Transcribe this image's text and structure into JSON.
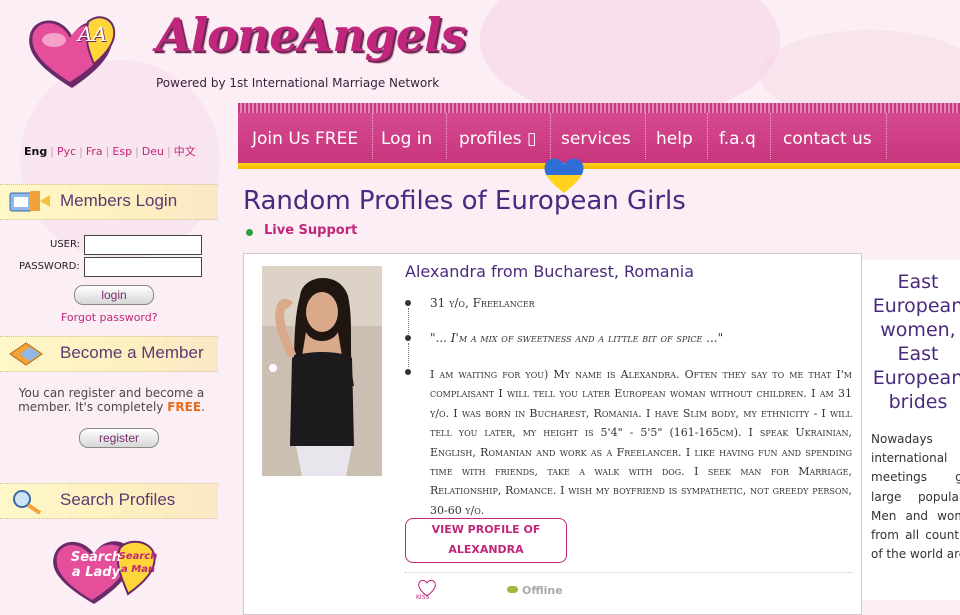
{
  "header": {
    "logo_text": "AloneAngels",
    "logo_monogram": "AA",
    "tagline": "Powered by 1st International Marriage Network"
  },
  "languages": {
    "current": "Eng",
    "others": [
      "Рус",
      "Fra",
      "Esp",
      "Deu",
      "中文"
    ]
  },
  "sidebar": {
    "members_login": {
      "title": "Members Login",
      "user_label": "USER:",
      "password_label": "PASSWORD:",
      "login_button": "login",
      "forgot": "Forgot password?"
    },
    "become_member": {
      "title": "Become a Member",
      "text_before": "You can register and become a member. It's completely",
      "free": "FREE",
      "text_after": ".",
      "register_button": "register"
    },
    "search_profiles": {
      "title": "Search Profiles",
      "badge_lady": "Search a Lady",
      "badge_man": "Search a Man"
    }
  },
  "nav": {
    "items": [
      "Join Us FREE",
      "Log in",
      "profiles ▯",
      "services",
      "help",
      "f.a.q",
      "contact us"
    ]
  },
  "main": {
    "title": "Random Profiles of European Girls",
    "live_support": "Live Support",
    "profile": {
      "name": "Alexandra from Bucharest, Romania",
      "line1": "31 y/o, Freelancer",
      "quote": "\"... I'm a mix of sweetness and a little bit of spice ...\"",
      "bio": "I am waiting for you) My name is Alexandra. Often they say to me that I'm complaisant I will tell you later European woman without children. I am 31 y/o. I was born in Bucharest, Romania. I have Slim body, my ethnicity - I will tell you later, my height is 5'4\" - 5'5\" (161-165cm). I speak Ukrainian, English, Romanian and work as a Freelancer. I like having fun and spending time with friends, take a walk with dog. I seek man for Marriage, Relationship, Romance. I wish my boyfriend is sympathetic, not greedy person, 30-60 y/o.",
      "view_button": "VIEW PROFILE OF ALEXANDRA",
      "kiss_label": "KISS",
      "status": "Offline"
    }
  },
  "right_column": {
    "title": "East European women, East European brides",
    "text": "Nowadays international meetings gain large popularity. Men and women from all countries of the world are"
  },
  "colors": {
    "brand_pink": "#c0267b",
    "nav_bg": "#d54a90",
    "nav_accent": "#ffd21e",
    "title_purple": "#4a2a7e"
  }
}
